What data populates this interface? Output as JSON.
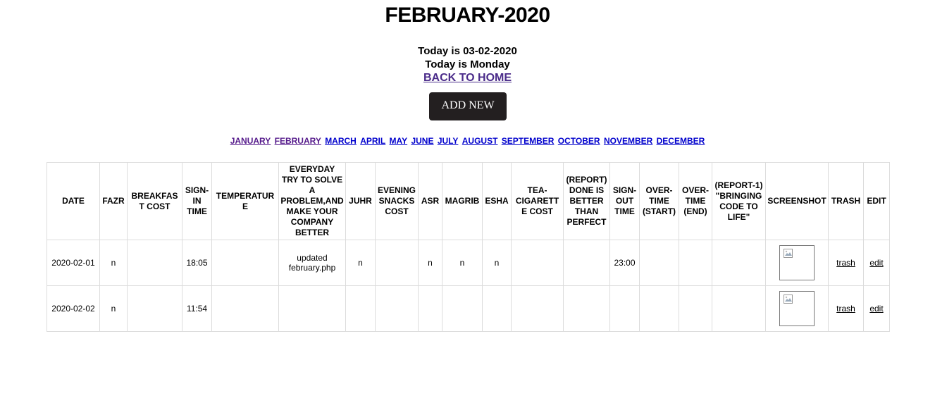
{
  "page": {
    "title": "FEBRUARY-2020",
    "today_date": "Today is 03-02-2020",
    "today_day": "Today is Monday",
    "back_link": "BACK TO HOME",
    "add_new": "ADD NEW"
  },
  "months": [
    "JANUARY",
    "FEBRUARY",
    "MARCH",
    "APRIL",
    "MAY",
    "JUNE",
    "JULY",
    "AUGUST",
    "SEPTEMBER",
    "OCTOBER",
    "NOVEMBER",
    "DECEMBER"
  ],
  "table": {
    "headers": [
      "DATE",
      "FAZR",
      "BREAKFAST COST",
      "SIGN-IN TIME",
      "TEMPERATURE",
      "EVERYDAY TRY TO SOLVE A PROBLEM,AND MAKE YOUR COMPANY BETTER",
      "JUHR",
      "EVENING SNACKS COST",
      "ASR",
      "MAGRIB",
      "ESHA",
      "TEA-CIGARETTE COST",
      "(REPORT) DONE IS BETTER THAN PERFECT",
      "SIGN-OUT TIME",
      "OVER-TIME (START)",
      "OVER-TIME (END)",
      "(REPORT-1) \"BRINGING CODE TO LIFE\"",
      "SCREENSHOT",
      "TRASH",
      "EDIT"
    ],
    "rows": [
      [
        "2020-02-01",
        "n",
        "",
        "18:05",
        "",
        "updated february.php",
        "n",
        "",
        "n",
        "n",
        "n",
        "",
        "",
        "23:00",
        "",
        "",
        "",
        "",
        "trash",
        "edit"
      ],
      [
        "2020-02-02",
        "n",
        "",
        "11:54",
        "",
        "",
        "",
        "",
        "",
        "",
        "",
        "",
        "",
        "",
        "",
        "",
        "",
        "",
        "trash",
        "edit"
      ]
    ]
  },
  "icons": {
    "broken_image": "broken-image-icon"
  }
}
